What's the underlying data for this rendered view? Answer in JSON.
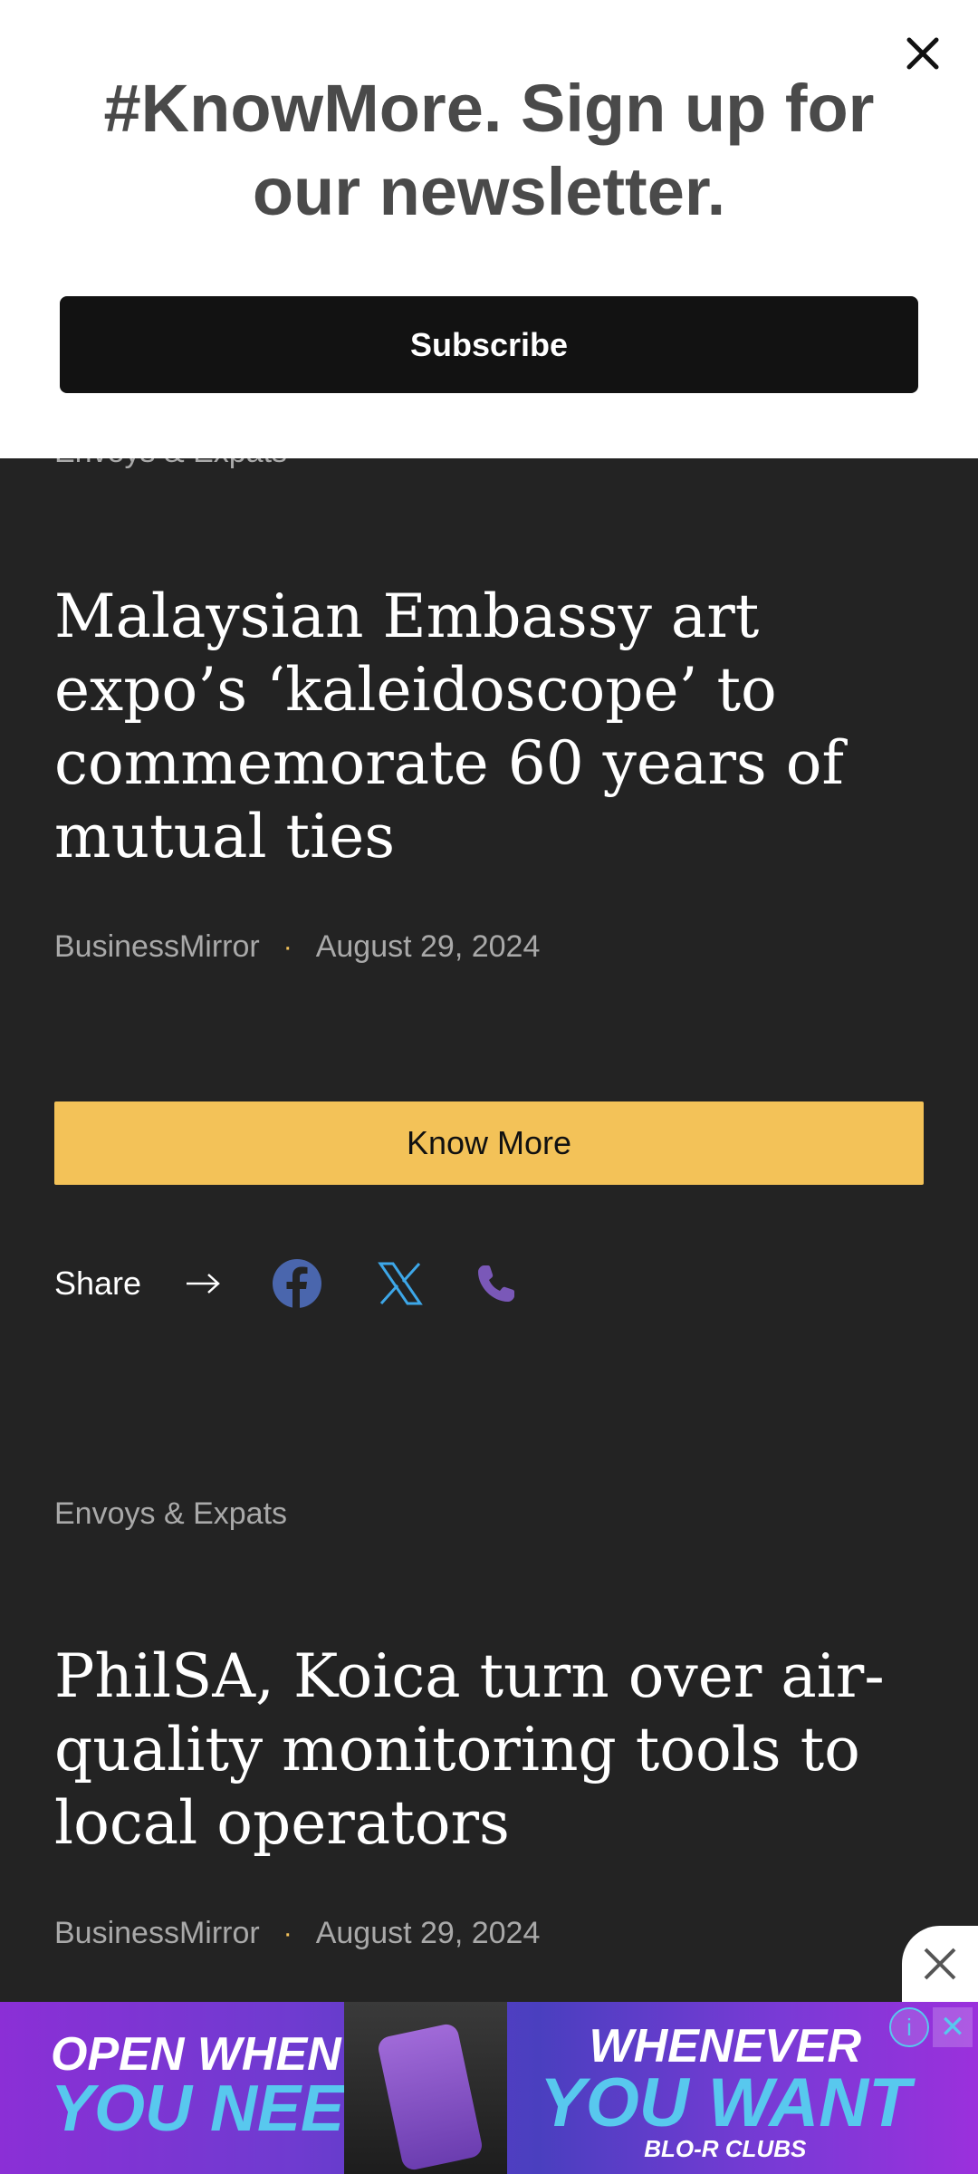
{
  "newsletter": {
    "title": "#KnowMore. Sign up for our newsletter.",
    "subscribe_label": "Subscribe",
    "close_icon": "close-icon"
  },
  "articles": [
    {
      "category": "Envoys & Expats",
      "headline": "Malaysian Embassy art expo’s ‘kaleidoscope’ to commemorate 60 years of mutual ties",
      "source": "BusinessMirror",
      "separator": "·",
      "date": "August 29, 2024",
      "cta_label": "Know More",
      "share_label": "Share"
    },
    {
      "category": "Envoys & Expats",
      "headline": "PhilSA, Koica turn over air-quality monitoring tools to local operators",
      "source": "BusinessMirror",
      "separator": "·",
      "date": "August 29, 2024"
    }
  ],
  "share_icons": [
    "arrow-right-icon",
    "facebook-icon",
    "x-twitter-icon",
    "phone-icon"
  ],
  "ad": {
    "left_line1": "OPEN WHEN",
    "left_line2": "YOU NEED US",
    "right_line1": "WHENEVER",
    "right_line2": "YOU WANT",
    "right_line3": "BLO-R CLUBS",
    "info_glyph": "i",
    "close_glyph": "✕"
  },
  "colors": {
    "background": "#232323",
    "accent_yellow": "#f3c258",
    "facebook": "#4a66ad",
    "x_twitter": "#3da7e8",
    "phone": "#7a58b8",
    "ad_purple": "#8b2fd6",
    "ad_cyan": "#58c8ee"
  }
}
